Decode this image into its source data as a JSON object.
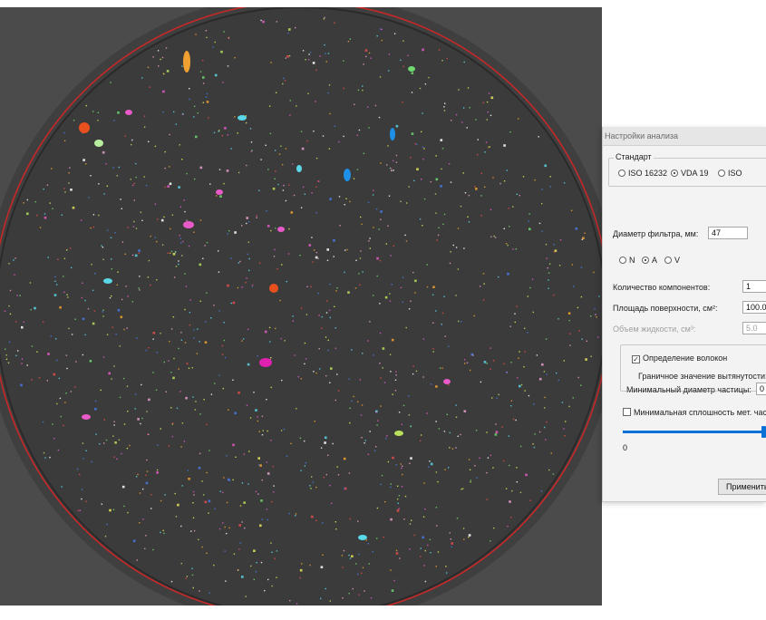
{
  "image_view": {
    "background": "#4a4a4a",
    "boundary_color": "#c62828"
  },
  "settings": {
    "title": "Настройки анализа",
    "standard_group": {
      "legend": "Стандарт",
      "options": [
        "ISO 16232",
        "VDA 19",
        "ISO"
      ],
      "selected": "VDA 19"
    },
    "filter_diameter": {
      "label": "Диаметр фильтра, мм:",
      "value": "47"
    },
    "class_options": {
      "options": [
        "N",
        "A",
        "V"
      ],
      "selected": "A"
    },
    "components_count": {
      "label": "Количество компонентов:",
      "value": "1"
    },
    "surface_area": {
      "label": "Площадь поверхности, см²:",
      "value": "100.0"
    },
    "liquid_volume": {
      "label": "Объем жидкости, см³:",
      "value": "5.0"
    },
    "fiber_detection": {
      "label": "Определение волокон",
      "checked": true,
      "threshold_label": "Граничное значение вытянутости:"
    },
    "min_particle_diameter": {
      "label": "Минимальный диаметр частицы:",
      "value": "0"
    },
    "min_metal_density": {
      "label": "Минимальная сплошность мет. част",
      "checked": false
    },
    "slider": {
      "value_label": "0",
      "level_fraction": 0.97,
      "color": "#0a72d6"
    },
    "apply_label": "Применить"
  }
}
